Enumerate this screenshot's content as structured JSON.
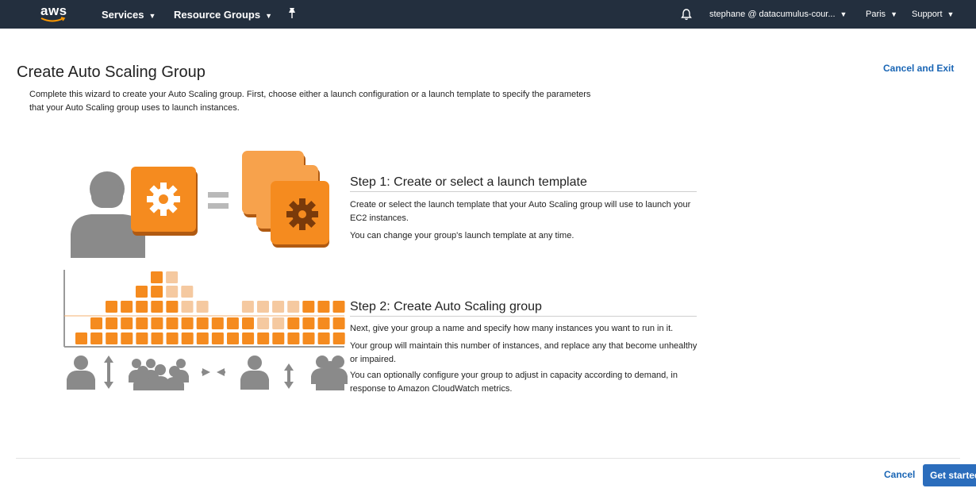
{
  "nav": {
    "logo_text": "aws",
    "services": "Services",
    "resource_groups": "Resource Groups",
    "account": "stephane @ datacumulus-cour...",
    "region": "Paris",
    "support": "Support"
  },
  "header": {
    "title": "Create Auto Scaling Group",
    "cancel_exit": "Cancel and Exit",
    "intro_line1": "Complete this wizard to create your Auto Scaling group. First, choose either a launch configuration or a launch template to specify the parameters",
    "intro_line2": "that your Auto Scaling group uses to launch instances."
  },
  "step1": {
    "title": "Step 1: Create or select a launch template",
    "p1": "Create or select the launch template that your Auto Scaling group will use to launch your EC2 instances.",
    "p2": "You can change your group's launch template at any time."
  },
  "step2": {
    "title": "Step 2: Create Auto Scaling group",
    "p1": "Next, give your group a name and specify how many instances you want to run in it.",
    "p2": "Your group will maintain this number of instances, and replace any that become unhealthy or impaired.",
    "p3": "You can optionally configure your group to adjust in capacity according to demand, in response to Amazon CloudWatch metrics."
  },
  "footer": {
    "cancel": "Cancel",
    "get_started": "Get started"
  },
  "colors": {
    "nav_bg": "#232f3e",
    "orange": "#f58b1f",
    "light_orange": "#f5c9a0",
    "gray": "#8a8a8a",
    "link": "#1a66b5",
    "primary_button": "#2b6dbc"
  }
}
